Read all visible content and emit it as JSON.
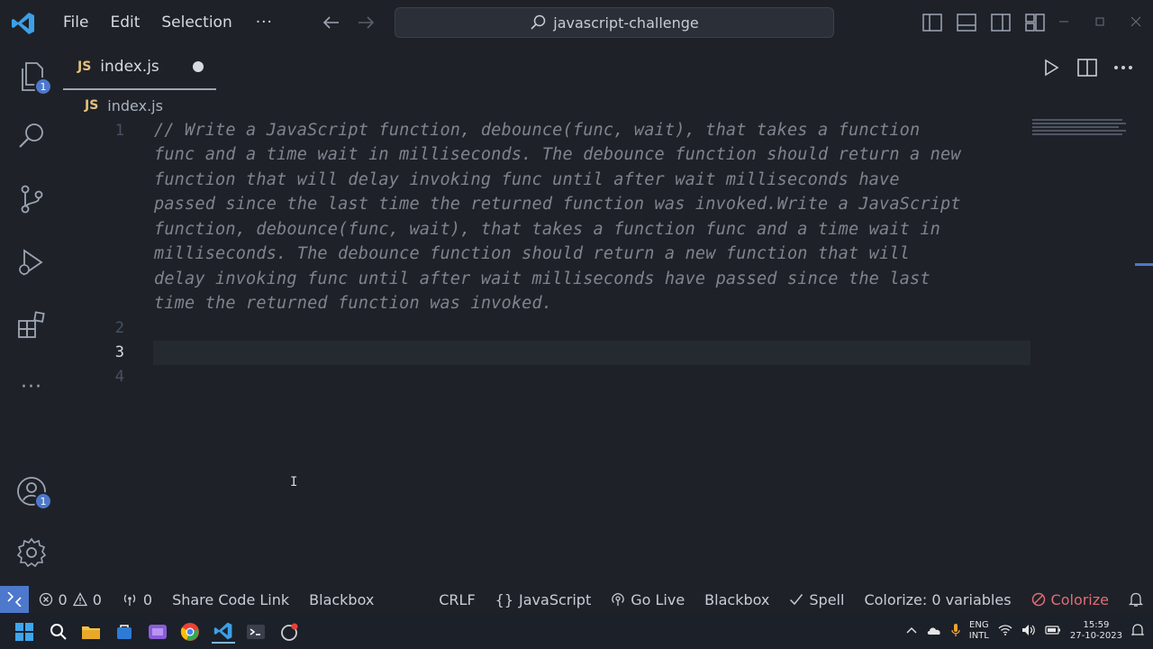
{
  "menu": {
    "file": "File",
    "edit": "Edit",
    "selection": "Selection",
    "more": "···"
  },
  "command_center": {
    "text": "javascript-challenge"
  },
  "activity_bar": {
    "explorer_badge": "1",
    "accounts_badge": "1",
    "more": "···"
  },
  "tab": {
    "lang": "JS",
    "filename": "index.js"
  },
  "breadcrumb": {
    "lang": "JS",
    "filename": "index.js"
  },
  "editor": {
    "line_numbers": [
      "1",
      "2",
      "3",
      "4"
    ],
    "comment_lines": [
      "// Write a JavaScript function, debounce(func, wait), that takes a function",
      "func and a time wait in milliseconds. The debounce function should return a new",
      "function that will delay invoking func until after wait milliseconds have",
      "passed since the last time the returned function was invoked.Write a JavaScript",
      "function, debounce(func, wait), that takes a function func and a time wait in",
      "milliseconds. The debounce function should return a new function that will",
      "delay invoking func until after wait milliseconds have passed since the last",
      "time the returned function was invoked."
    ],
    "mouse_cursor": "I"
  },
  "statusbar": {
    "errors": "0",
    "warnings": "0",
    "ports": "0",
    "share": "Share Code Link",
    "blackbox_left": "Blackbox",
    "eol": "CRLF",
    "language_braces": "{}",
    "language": "JavaScript",
    "golive": "Go Live",
    "blackbox_right": "Blackbox",
    "spell": "Spell",
    "colorize_vars": "Colorize: 0 variables",
    "colorize": "Colorize"
  },
  "taskbar": {
    "lang_top": "ENG",
    "lang_bottom": "INTL",
    "time": "15:59",
    "date": "27-10-2023"
  },
  "colors": {
    "accent": "#4d78cc",
    "comment": "#7f848e",
    "js_badge": "#e5c07b",
    "error_red": "#e06c75"
  }
}
